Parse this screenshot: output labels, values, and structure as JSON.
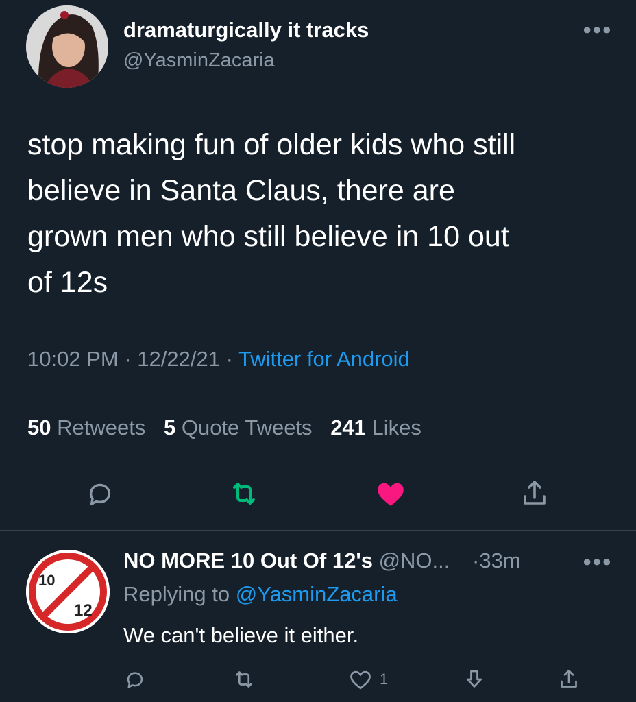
{
  "tweet": {
    "display_name": "dramaturgically it tracks",
    "handle": "@YasminZacaria",
    "more_icon": "more-horizontal-icon",
    "text": "stop making fun of older kids who still\nbelieve in Santa Claus, there are\ngrown men who still believe in 10 out\nof 12s",
    "time": "10:02 PM",
    "date": "12/22/21",
    "source": "Twitter for Android",
    "separator": "·",
    "stats": {
      "retweets_count": "50",
      "retweets_label": "Retweets",
      "quotes_count": "5",
      "quotes_label": "Quote Tweets",
      "likes_count": "241",
      "likes_label": "Likes"
    },
    "actions": [
      "reply-icon",
      "retweet-icon",
      "like-icon",
      "share-icon"
    ],
    "colors": {
      "retweet_active": "#00ba7c",
      "like_active": "#f91880",
      "link": "#1d9bf0"
    }
  },
  "reply": {
    "display_name": "NO MORE 10 Out Of 12's",
    "handle": "@NO...",
    "time": "·33m",
    "replying_prefix": "Replying to",
    "replying_handle": "@YasminZacaria",
    "text": "We can't believe it either.",
    "like_count": "1",
    "avatar_logo_text": "10 OUT OF 12",
    "actions": [
      "reply-icon",
      "retweet-icon",
      "like-icon",
      "downvote-icon",
      "share-icon"
    ]
  }
}
